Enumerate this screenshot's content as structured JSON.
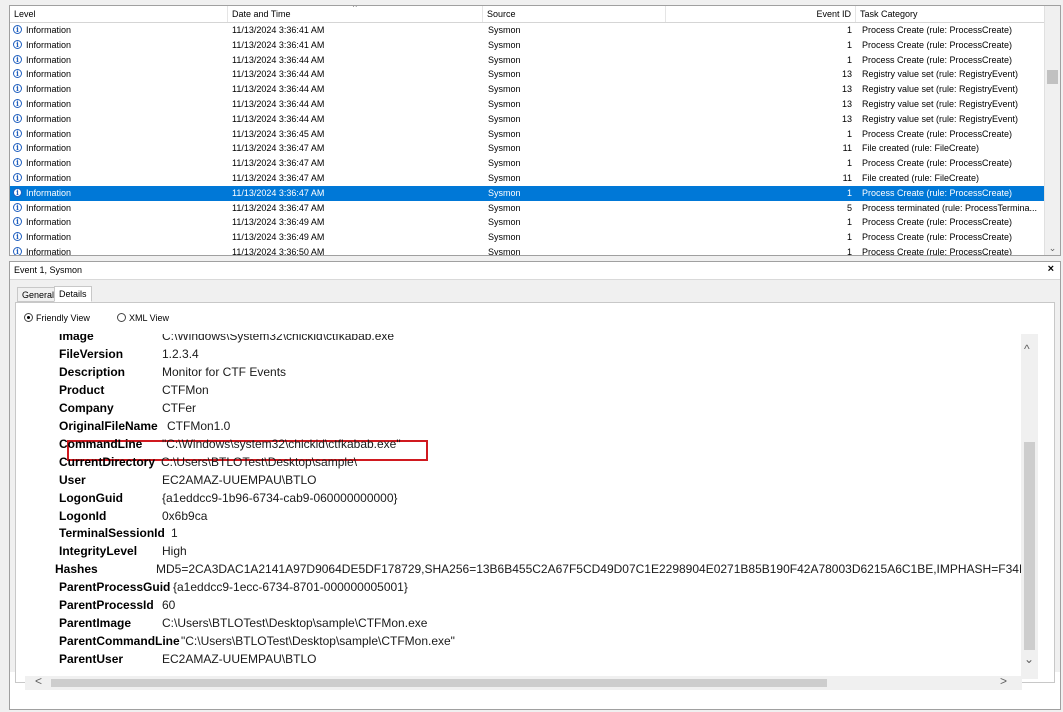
{
  "columns": {
    "level": "Level",
    "date_time": "Date and Time",
    "source": "Source",
    "event_id": "Event ID",
    "task_category": "Task Category"
  },
  "events": [
    {
      "level": "Information",
      "date": "11/13/2024 3:36:41 AM",
      "source": "Sysmon",
      "id": "1",
      "task": "Process Create (rule: ProcessCreate)"
    },
    {
      "level": "Information",
      "date": "11/13/2024 3:36:41 AM",
      "source": "Sysmon",
      "id": "1",
      "task": "Process Create (rule: ProcessCreate)"
    },
    {
      "level": "Information",
      "date": "11/13/2024 3:36:44 AM",
      "source": "Sysmon",
      "id": "1",
      "task": "Process Create (rule: ProcessCreate)"
    },
    {
      "level": "Information",
      "date": "11/13/2024 3:36:44 AM",
      "source": "Sysmon",
      "id": "13",
      "task": "Registry value set (rule: RegistryEvent)"
    },
    {
      "level": "Information",
      "date": "11/13/2024 3:36:44 AM",
      "source": "Sysmon",
      "id": "13",
      "task": "Registry value set (rule: RegistryEvent)"
    },
    {
      "level": "Information",
      "date": "11/13/2024 3:36:44 AM",
      "source": "Sysmon",
      "id": "13",
      "task": "Registry value set (rule: RegistryEvent)"
    },
    {
      "level": "Information",
      "date": "11/13/2024 3:36:44 AM",
      "source": "Sysmon",
      "id": "13",
      "task": "Registry value set (rule: RegistryEvent)"
    },
    {
      "level": "Information",
      "date": "11/13/2024 3:36:45 AM",
      "source": "Sysmon",
      "id": "1",
      "task": "Process Create (rule: ProcessCreate)"
    },
    {
      "level": "Information",
      "date": "11/13/2024 3:36:47 AM",
      "source": "Sysmon",
      "id": "11",
      "task": "File created (rule: FileCreate)"
    },
    {
      "level": "Information",
      "date": "11/13/2024 3:36:47 AM",
      "source": "Sysmon",
      "id": "1",
      "task": "Process Create (rule: ProcessCreate)"
    },
    {
      "level": "Information",
      "date": "11/13/2024 3:36:47 AM",
      "source": "Sysmon",
      "id": "11",
      "task": "File created (rule: FileCreate)"
    },
    {
      "level": "Information",
      "date": "11/13/2024 3:36:47 AM",
      "source": "Sysmon",
      "id": "1",
      "task": "Process Create (rule: ProcessCreate)",
      "selected": true
    },
    {
      "level": "Information",
      "date": "11/13/2024 3:36:47 AM",
      "source": "Sysmon",
      "id": "5",
      "task": "Process terminated (rule: ProcessTermina..."
    },
    {
      "level": "Information",
      "date": "11/13/2024 3:36:49 AM",
      "source": "Sysmon",
      "id": "1",
      "task": "Process Create (rule: ProcessCreate)"
    },
    {
      "level": "Information",
      "date": "11/13/2024 3:36:49 AM",
      "source": "Sysmon",
      "id": "1",
      "task": "Process Create (rule: ProcessCreate)"
    },
    {
      "level": "Information",
      "date": "11/13/2024 3:36:50 AM",
      "source": "Sysmon",
      "id": "1",
      "task": "Process Create (rule: ProcessCreate)"
    }
  ],
  "pane": {
    "title": "Event 1, Sysmon",
    "close": "×",
    "tab_general": "General",
    "tab_details": "Details",
    "friendly_view": "Friendly View",
    "xml_view": "XML View"
  },
  "details": [
    {
      "key": "Image",
      "value": "C:\\Windows\\System32\\chickid\\ctfkabab.exe"
    },
    {
      "key": "FileVersion",
      "value": "1.2.3.4"
    },
    {
      "key": "Description",
      "value": "Monitor for CTF Events"
    },
    {
      "key": "Product",
      "value": "CTFMon"
    },
    {
      "key": "Company",
      "value": "CTFer"
    },
    {
      "key": "OriginalFileName",
      "value": "CTFMon1.0"
    },
    {
      "key": "CommandLine",
      "value": "\"C:\\Windows\\system32\\chickid\\ctfkabab.exe\"",
      "highlighted": true
    },
    {
      "key": "CurrentDirectory",
      "value": "C:\\Users\\BTLOTest\\Desktop\\sample\\"
    },
    {
      "key": "User",
      "value": "EC2AMAZ-UUEMPAU\\BTLO"
    },
    {
      "key": "LogonGuid",
      "value": "{a1eddcc9-1b96-6734-cab9-060000000000}"
    },
    {
      "key": "LogonId",
      "value": "0x6b9ca"
    },
    {
      "key": "TerminalSessionId",
      "value": "1"
    },
    {
      "key": "IntegrityLevel",
      "value": "High"
    },
    {
      "key": "Hashes",
      "value": "MD5=2CA3DAC1A2141A97D9064DE5DF178729,SHA256=13B6B455C2A67F5CD49D07C1E2298904E0271B85B190F42A78003D6215A6C1BE,IMPHASH=F34I"
    },
    {
      "key": "ParentProcessGuid",
      "value": "{a1eddcc9-1ecc-6734-8701-000000005001}"
    },
    {
      "key": "ParentProcessId",
      "value": "60"
    },
    {
      "key": "ParentImage",
      "value": "C:\\Users\\BTLOTest\\Desktop\\sample\\CTFMon.exe"
    },
    {
      "key": "ParentCommandLine",
      "value": "\"C:\\Users\\BTLOTest\\Desktop\\sample\\CTFMon.exe\""
    },
    {
      "key": "ParentUser",
      "value": "EC2AMAZ-UUEMPAU\\BTLO"
    }
  ]
}
